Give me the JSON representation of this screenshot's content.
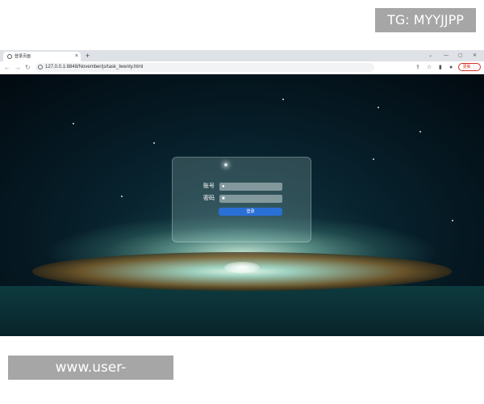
{
  "watermarks": {
    "top": "TG: MYYJJPP",
    "bottom": "www.user-pgyulecn.com"
  },
  "browser": {
    "tab": {
      "title": "登录页面",
      "close": "×",
      "new_tab": "+"
    },
    "window_controls": {
      "chevron": "⌄",
      "minimize": "—",
      "restore": "▢",
      "close": "✕"
    },
    "nav": {
      "back": "←",
      "forward": "→",
      "reload": "↻"
    },
    "url": "127.0.0.1:8848/November/js/task_twenty.html",
    "toolbar_icons": {
      "share": "⇪",
      "bookmark": "☆",
      "sidebar": "▮",
      "profile": "●"
    },
    "update_label": "更新 ⋮"
  },
  "login": {
    "account_label": "账号",
    "password_label": "密码",
    "account_placeholder": "",
    "password_placeholder": "",
    "submit_label": "登录"
  },
  "colors": {
    "accent": "#2a6fd6",
    "update": "#d93025"
  }
}
